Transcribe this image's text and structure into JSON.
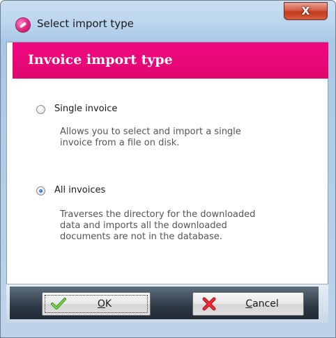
{
  "window": {
    "title": "Select import type",
    "app_icon": "pink-app-icon",
    "close_glyph": "X"
  },
  "banner": {
    "title": "Invoice import type",
    "color": "#e8077a"
  },
  "options": [
    {
      "label": "Single invoice",
      "description_lines": [
        "Allows you to select and import a single",
        "invoice from a file on disk."
      ],
      "checked": false
    },
    {
      "label": "All invoices",
      "description_lines": [
        "Traverses the directory for the downloaded",
        "data and imports all the downloaded",
        "documents are not in the database."
      ],
      "checked": true
    }
  ],
  "buttons": {
    "ok": {
      "label": "OK",
      "mnemonic": "O",
      "rest": "K",
      "icon": "green-checkmark-icon"
    },
    "cancel": {
      "label": "Cancel",
      "mnemonic": "C",
      "rest": "ancel",
      "icon": "red-x-icon"
    }
  }
}
